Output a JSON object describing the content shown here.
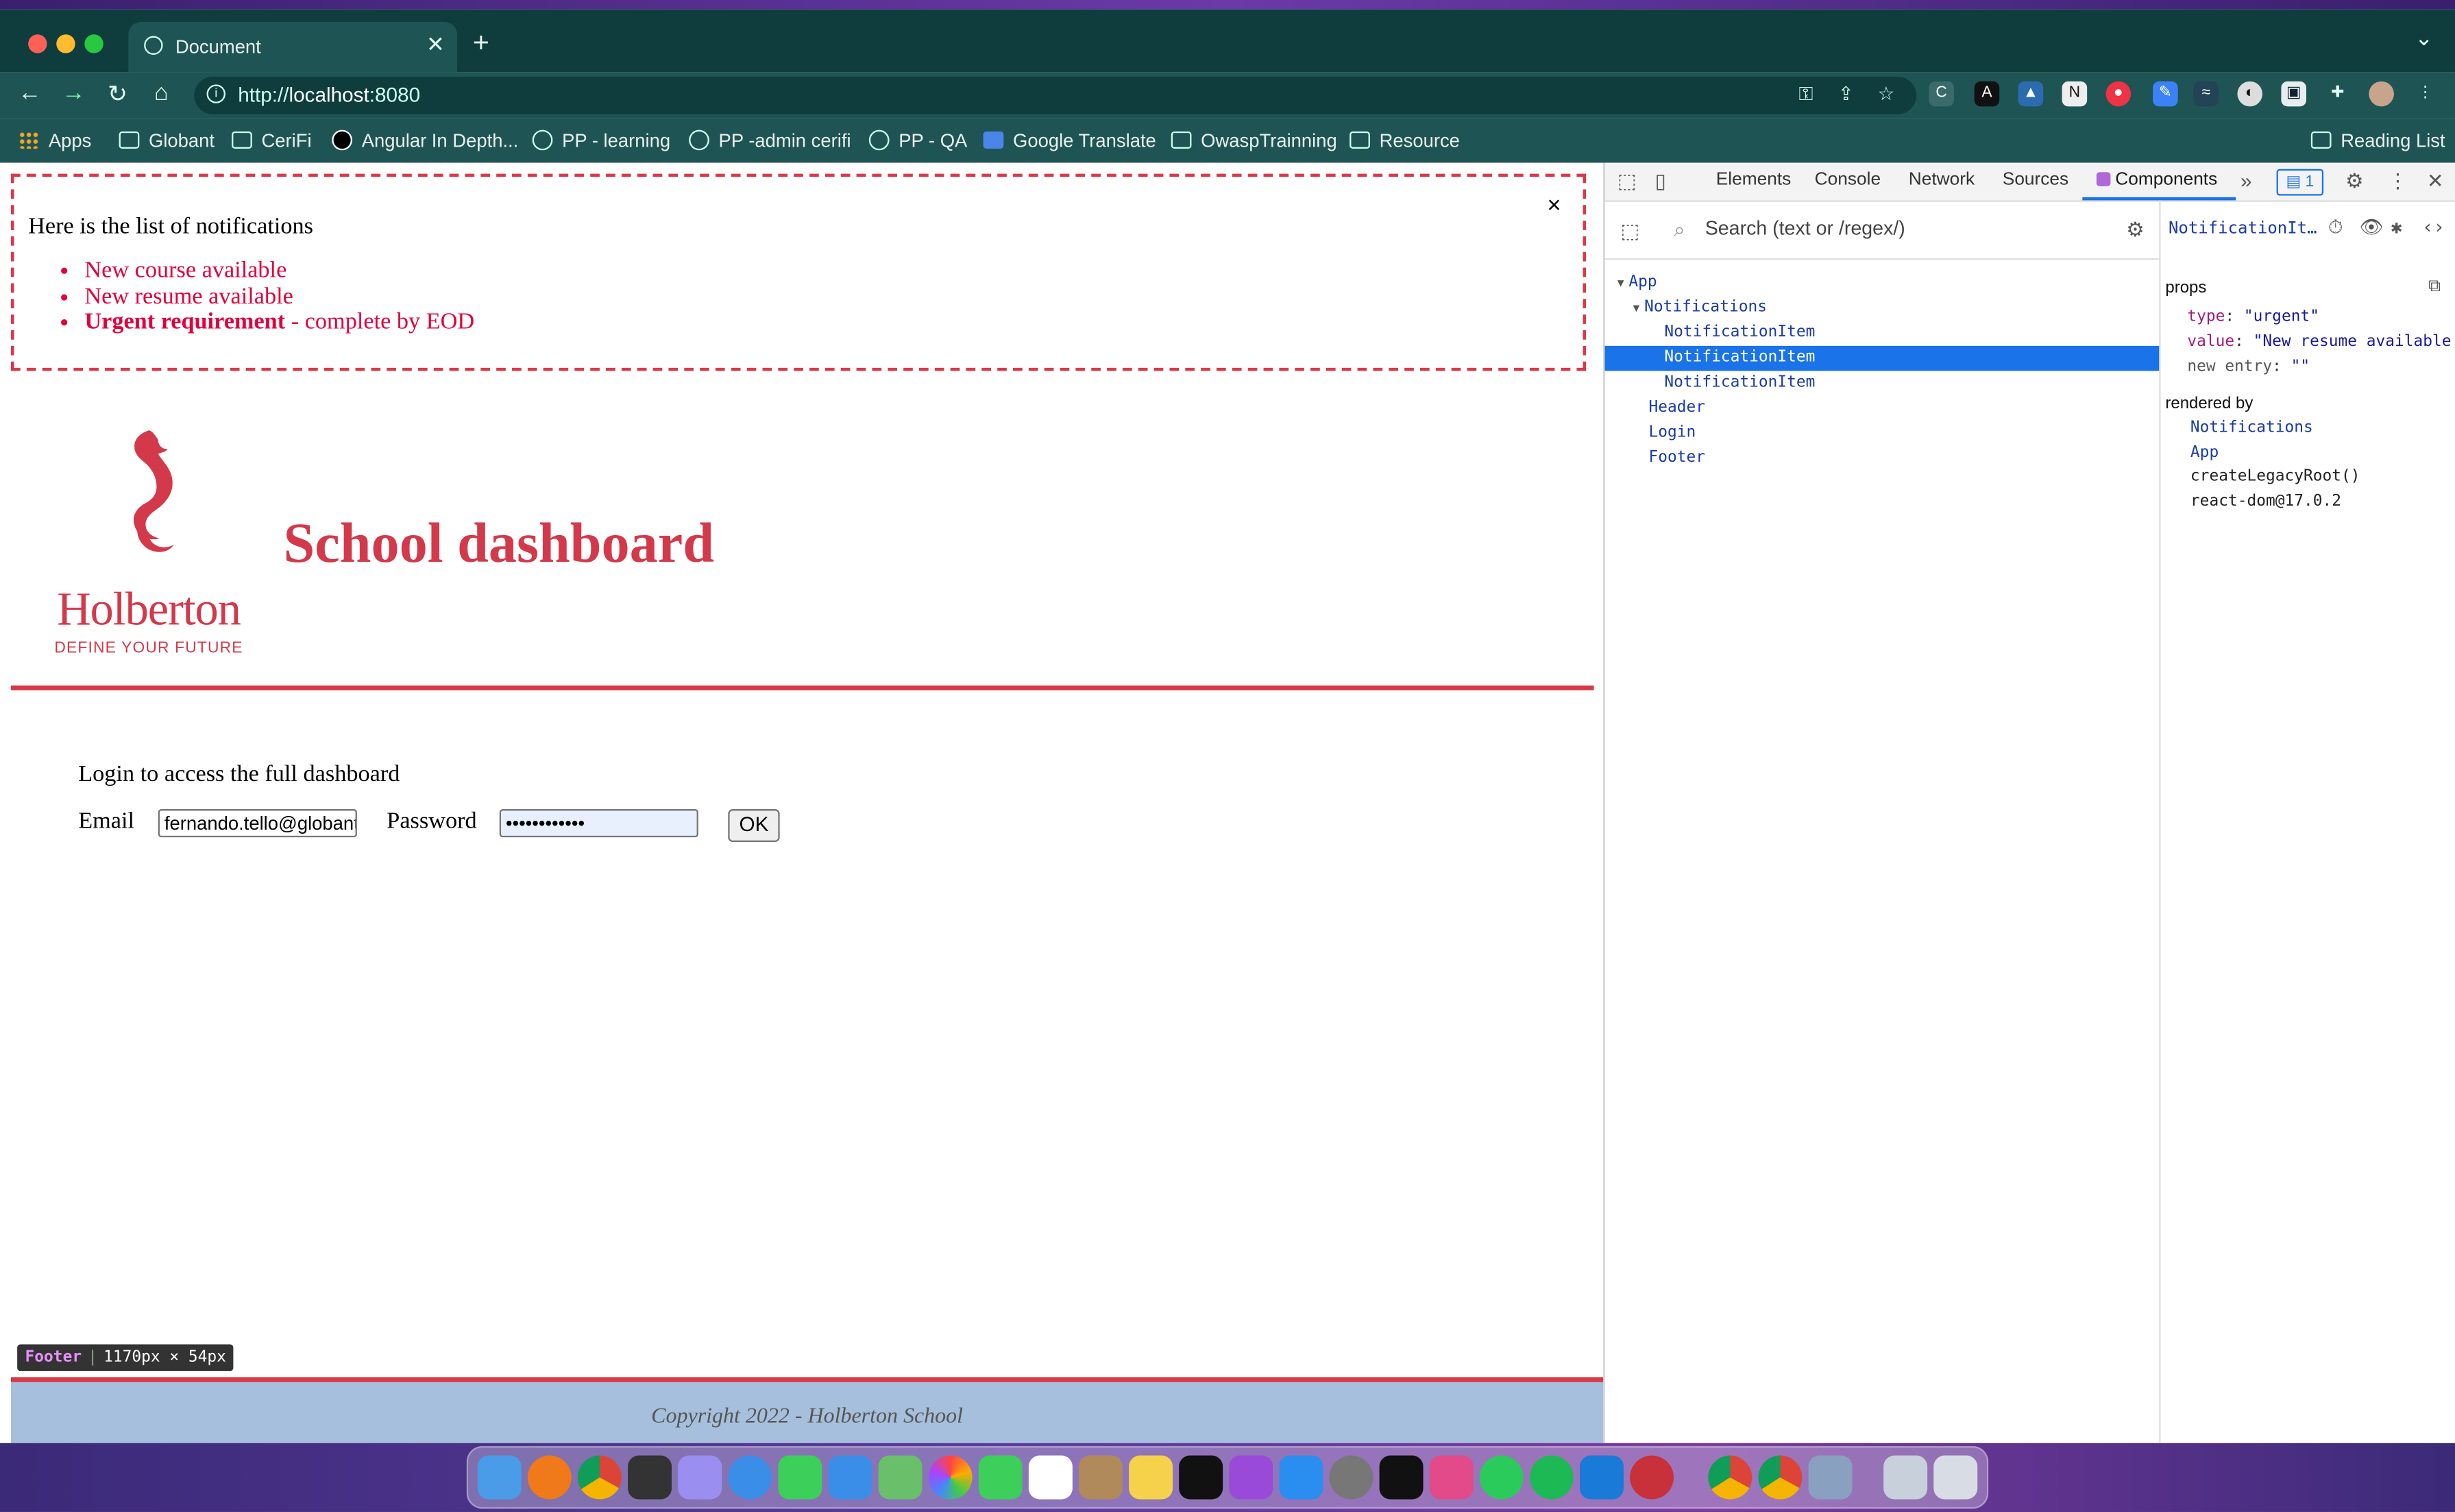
{
  "browser": {
    "tab_title": "Document",
    "url_prefix": "http://",
    "url_host": "localhost",
    "url_suffix": ":8080",
    "reading_list": "Reading List"
  },
  "bookmarks": [
    "Apps",
    "Globant",
    "CeriFi",
    "Angular In Depth...",
    "PP - learning",
    "PP -admin cerifi",
    "PP - QA",
    "Google Translate",
    "OwaspTrainning",
    "Resource"
  ],
  "notifications": {
    "heading": "Here is the list of notifications",
    "items": [
      "New course available",
      "New resume available"
    ],
    "urgent_bold": "Urgent requirement",
    "urgent_rest": " - complete by EOD",
    "close": "×"
  },
  "header": {
    "logo_word": "Holberton",
    "logo_tagline": "DEFINE YOUR FUTURE",
    "title": "School dashboard"
  },
  "login": {
    "prompt": "Login to access the full dashboard",
    "email_label": "Email",
    "email_value": "fernando.tello@globant",
    "password_label": "Password",
    "password_value": "••••••••••••",
    "ok_label": "OK"
  },
  "inspector_tip": {
    "name": "Footer",
    "size": "1170px × 54px"
  },
  "footer": {
    "copyright": "Copyright 2022 - Holberton School"
  },
  "devtools": {
    "tabs": [
      "Elements",
      "Console",
      "Network",
      "Sources",
      "Components"
    ],
    "active_tab": "Components",
    "badge": "1",
    "search_placeholder": "Search (text or /regex/)",
    "tree": [
      {
        "label": "App",
        "expanded": true
      },
      {
        "label": "Notifications",
        "expanded": true
      },
      {
        "label": "NotificationItem"
      },
      {
        "label": "NotificationItem",
        "selected": true
      },
      {
        "label": "NotificationItem"
      },
      {
        "label": "Header"
      },
      {
        "label": "Login"
      },
      {
        "label": "Footer"
      }
    ],
    "selected_header": "NotificationIt…",
    "props_title": "props",
    "props": [
      {
        "key": "type",
        "value": "\"urgent\""
      },
      {
        "key": "value",
        "value": "\"New resume available"
      },
      {
        "key": "new entry",
        "value": "\"\""
      }
    ],
    "rendered_by_title": "rendered by",
    "rendered_by": [
      "Notifications",
      "App",
      "createLegacyRoot()",
      "react-dom@17.0.2"
    ]
  },
  "colors": {
    "holberton_red": "#d3394a",
    "notification_red": "#e1003c",
    "chrome_bar": "#1f5454",
    "devtools_blue": "#1a73e8",
    "footer_blue": "#a6bfdc"
  }
}
